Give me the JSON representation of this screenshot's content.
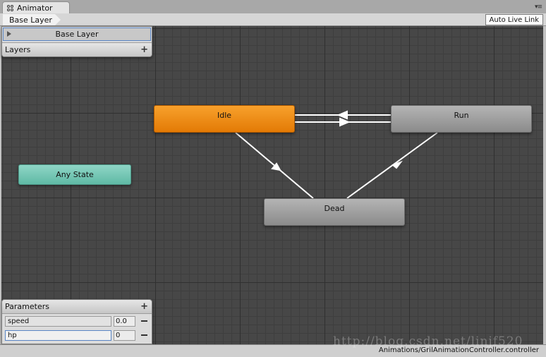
{
  "window": {
    "tab_title": "Animator",
    "tab_menu_glyph": "▾≡"
  },
  "toolbar": {
    "breadcrumb": "Base Layer",
    "auto_live_link_label": "Auto Live Link"
  },
  "layers_panel": {
    "selected_layer": "Base Layer",
    "header_label": "Layers",
    "add_glyph": "+"
  },
  "states": {
    "idle": "Idle",
    "run": "Run",
    "dead": "Dead",
    "any_state": "Any State"
  },
  "parameters_panel": {
    "header_label": "Parameters",
    "add_glyph": "+",
    "items": [
      {
        "name": "speed",
        "value": "0.0"
      },
      {
        "name": "hp",
        "value": "0"
      }
    ]
  },
  "status_bar": {
    "path": "Animations/GrilAnimationController.controller"
  },
  "watermark": "http://blog.csdn.net/linjf520",
  "colors": {
    "default_state": "#f39422",
    "state": "#a0a0a0",
    "any_state": "#7fcab9",
    "graph_background": "#474747"
  },
  "icons": {
    "window_tab": "animator-icon",
    "layer_expand": "triangle-right-icon",
    "add": "plus-icon",
    "remove": "minus-icon"
  }
}
